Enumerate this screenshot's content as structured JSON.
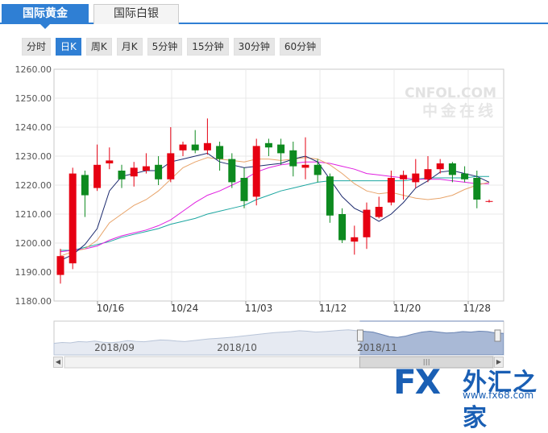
{
  "tabs": [
    {
      "label": "国际黄金",
      "active": true
    },
    {
      "label": "国际白银",
      "active": false
    }
  ],
  "periods": [
    {
      "label": "分时",
      "active": false
    },
    {
      "label": "日K",
      "active": true
    },
    {
      "label": "周K",
      "active": false
    },
    {
      "label": "月K",
      "active": false
    },
    {
      "label": "5分钟",
      "active": false
    },
    {
      "label": "15分钟",
      "active": false
    },
    {
      "label": "30分钟",
      "active": false
    },
    {
      "label": "60分钟",
      "active": false
    }
  ],
  "watermark": {
    "brand": "CNFOL.COM",
    "cn": "中金在线"
  },
  "logo": {
    "fx": "FX",
    "cn": "外汇之家",
    "url": "www.fx68.com"
  },
  "chart_data": {
    "type": "candlestick",
    "ylim": [
      1180,
      1260
    ],
    "yticks": [
      "1180.00",
      "1190.00",
      "1200.00",
      "1210.00",
      "1220.00",
      "1230.00",
      "1240.00",
      "1250.00",
      "1260.00"
    ],
    "xticks": [
      "10/16",
      "10/24",
      "11/03",
      "11/12",
      "11/20",
      "11/28"
    ],
    "colors": {
      "up": "#e60012",
      "down": "#0d8a1f",
      "ma5": "#1c2a6e",
      "ma10": "#e8a46a",
      "ma20": "#e020e0",
      "ma30": "#1ca6a0"
    },
    "candles": [
      {
        "o": 1189.0,
        "c": 1195.5,
        "h": 1198.0,
        "l": 1186.0
      },
      {
        "o": 1193.0,
        "c": 1224.0,
        "h": 1226.0,
        "l": 1191.0
      },
      {
        "o": 1223.5,
        "c": 1216.5,
        "h": 1225.0,
        "l": 1209.0
      },
      {
        "o": 1219.0,
        "c": 1227.0,
        "h": 1234.0,
        "l": 1218.0
      },
      {
        "o": 1227.5,
        "c": 1228.5,
        "h": 1233.0,
        "l": 1225.5
      },
      {
        "o": 1225.0,
        "c": 1222.0,
        "h": 1227.0,
        "l": 1219.0
      },
      {
        "o": 1223.0,
        "c": 1226.0,
        "h": 1228.0,
        "l": 1219.5
      },
      {
        "o": 1225.0,
        "c": 1226.5,
        "h": 1231.0,
        "l": 1224.0
      },
      {
        "o": 1227.0,
        "c": 1222.0,
        "h": 1230.0,
        "l": 1220.0
      },
      {
        "o": 1222.0,
        "c": 1231.0,
        "h": 1240.0,
        "l": 1221.0
      },
      {
        "o": 1232.0,
        "c": 1234.0,
        "h": 1235.0,
        "l": 1230.0
      },
      {
        "o": 1234.0,
        "c": 1232.0,
        "h": 1239.0,
        "l": 1231.0
      },
      {
        "o": 1232.0,
        "c": 1234.5,
        "h": 1243.0,
        "l": 1230.5
      },
      {
        "o": 1233.5,
        "c": 1229.0,
        "h": 1235.0,
        "l": 1225.0
      },
      {
        "o": 1229.0,
        "c": 1221.0,
        "h": 1231.0,
        "l": 1219.0
      },
      {
        "o": 1222.5,
        "c": 1214.5,
        "h": 1226.0,
        "l": 1212.0
      },
      {
        "o": 1216.0,
        "c": 1233.5,
        "h": 1236.0,
        "l": 1213.0
      },
      {
        "o": 1234.5,
        "c": 1233.0,
        "h": 1236.0,
        "l": 1230.0
      },
      {
        "o": 1234.0,
        "c": 1231.0,
        "h": 1236.0,
        "l": 1227.0
      },
      {
        "o": 1232.0,
        "c": 1226.5,
        "h": 1235.0,
        "l": 1223.0
      },
      {
        "o": 1226.0,
        "c": 1227.0,
        "h": 1236.5,
        "l": 1222.0
      },
      {
        "o": 1227.0,
        "c": 1223.5,
        "h": 1229.0,
        "l": 1221.0
      },
      {
        "o": 1223.0,
        "c": 1209.5,
        "h": 1224.0,
        "l": 1207.0
      },
      {
        "o": 1210.0,
        "c": 1201.0,
        "h": 1212.0,
        "l": 1200.0
      },
      {
        "o": 1200.5,
        "c": 1202.0,
        "h": 1206.0,
        "l": 1196.0
      },
      {
        "o": 1202.0,
        "c": 1211.5,
        "h": 1214.0,
        "l": 1198.0
      },
      {
        "o": 1209.0,
        "c": 1212.5,
        "h": 1216.0,
        "l": 1208.5
      },
      {
        "o": 1214.0,
        "c": 1222.5,
        "h": 1225.0,
        "l": 1213.0
      },
      {
        "o": 1222.0,
        "c": 1223.5,
        "h": 1225.0,
        "l": 1215.0
      },
      {
        "o": 1221.0,
        "c": 1224.0,
        "h": 1229.0,
        "l": 1219.0
      },
      {
        "o": 1222.0,
        "c": 1225.5,
        "h": 1230.0,
        "l": 1221.0
      },
      {
        "o": 1225.5,
        "c": 1227.5,
        "h": 1229.0,
        "l": 1224.0
      },
      {
        "o": 1227.5,
        "c": 1223.5,
        "h": 1228.0,
        "l": 1221.0
      },
      {
        "o": 1224.0,
        "c": 1222.0,
        "h": 1226.5,
        "l": 1221.0
      },
      {
        "o": 1222.5,
        "c": 1215.0,
        "h": 1225.0,
        "l": 1212.0
      },
      {
        "o": 1214.5,
        "c": 1214.5,
        "h": 1215.0,
        "l": 1214.0
      }
    ],
    "ma5": [
      1194.0,
      1196.0,
      1199.5,
      1205.0,
      1218.0,
      1223.0,
      1224.0,
      1225.0,
      1225.0,
      1228.0,
      1229.0,
      1230.0,
      1231.0,
      1228.0,
      1227.0,
      1226.0,
      1226.5,
      1227.0,
      1227.5,
      1229.0,
      1230.0,
      1228.0,
      1222.0,
      1216.0,
      1212.0,
      1210.0,
      1207.5,
      1210.0,
      1214.0,
      1219.0,
      1221.5,
      1224.5,
      1225.0,
      1224.0,
      1223.0,
      1221.0
    ],
    "ma10": [
      1195.5,
      1197.0,
      1198.0,
      1201.0,
      1207.0,
      1210.0,
      1213.0,
      1215.0,
      1218.0,
      1222.0,
      1226.0,
      1228.0,
      1229.5,
      1229.0,
      1228.5,
      1228.0,
      1229.0,
      1229.0,
      1228.5,
      1229.0,
      1229.5,
      1229.0,
      1227.0,
      1224.0,
      1220.5,
      1218.0,
      1217.0,
      1217.5,
      1216.5,
      1215.5,
      1215.0,
      1215.5,
      1216.5,
      1218.5,
      1220.0,
      1221.0
    ],
    "ma20": [
      1197.0,
      1197.5,
      1198.0,
      1199.0,
      1201.0,
      1202.5,
      1203.5,
      1204.5,
      1206.0,
      1208.0,
      1211.0,
      1214.0,
      1216.5,
      1218.0,
      1220.0,
      1222.0,
      1224.5,
      1226.0,
      1227.0,
      1227.5,
      1228.0,
      1228.0,
      1227.5,
      1226.5,
      1225.5,
      1224.0,
      1223.5,
      1223.0,
      1222.5,
      1222.0,
      1222.0,
      1222.0,
      1221.5,
      1221.0,
      1220.5,
      1220.5
    ],
    "ma30": [
      1197.5,
      1197.5,
      1198.5,
      1199.5,
      1200.5,
      1202.0,
      1203.0,
      1204.0,
      1205.0,
      1206.5,
      1207.5,
      1208.5,
      1210.0,
      1211.0,
      1212.0,
      1213.0,
      1215.0,
      1216.5,
      1218.0,
      1219.0,
      1220.0,
      1221.0,
      1221.5,
      1221.5,
      1221.5,
      1221.5,
      1221.5,
      1221.5,
      1221.5,
      1222.0,
      1222.5,
      1222.5,
      1222.5,
      1222.5,
      1223.0,
      1223.0
    ],
    "navigator": {
      "labels": [
        "2018/09",
        "2018/10",
        "2018/11"
      ],
      "levels": [
        0.3,
        0.34,
        0.32,
        0.38,
        0.36,
        0.4,
        0.35,
        0.33,
        0.36,
        0.42,
        0.39,
        0.37,
        0.41,
        0.45,
        0.44,
        0.4,
        0.38,
        0.42,
        0.46,
        0.5,
        0.52,
        0.55,
        0.58,
        0.62,
        0.66,
        0.7,
        0.74,
        0.78,
        0.8,
        0.82,
        0.86,
        0.84,
        0.8,
        0.82,
        0.85,
        0.88,
        0.9,
        0.86,
        0.83,
        0.8,
        0.7,
        0.6,
        0.56,
        0.62,
        0.72,
        0.8,
        0.84,
        0.8,
        0.76,
        0.78,
        0.82,
        0.8,
        0.84,
        0.82,
        0.76,
        0.74
      ],
      "selection_start": 0.68
    }
  }
}
